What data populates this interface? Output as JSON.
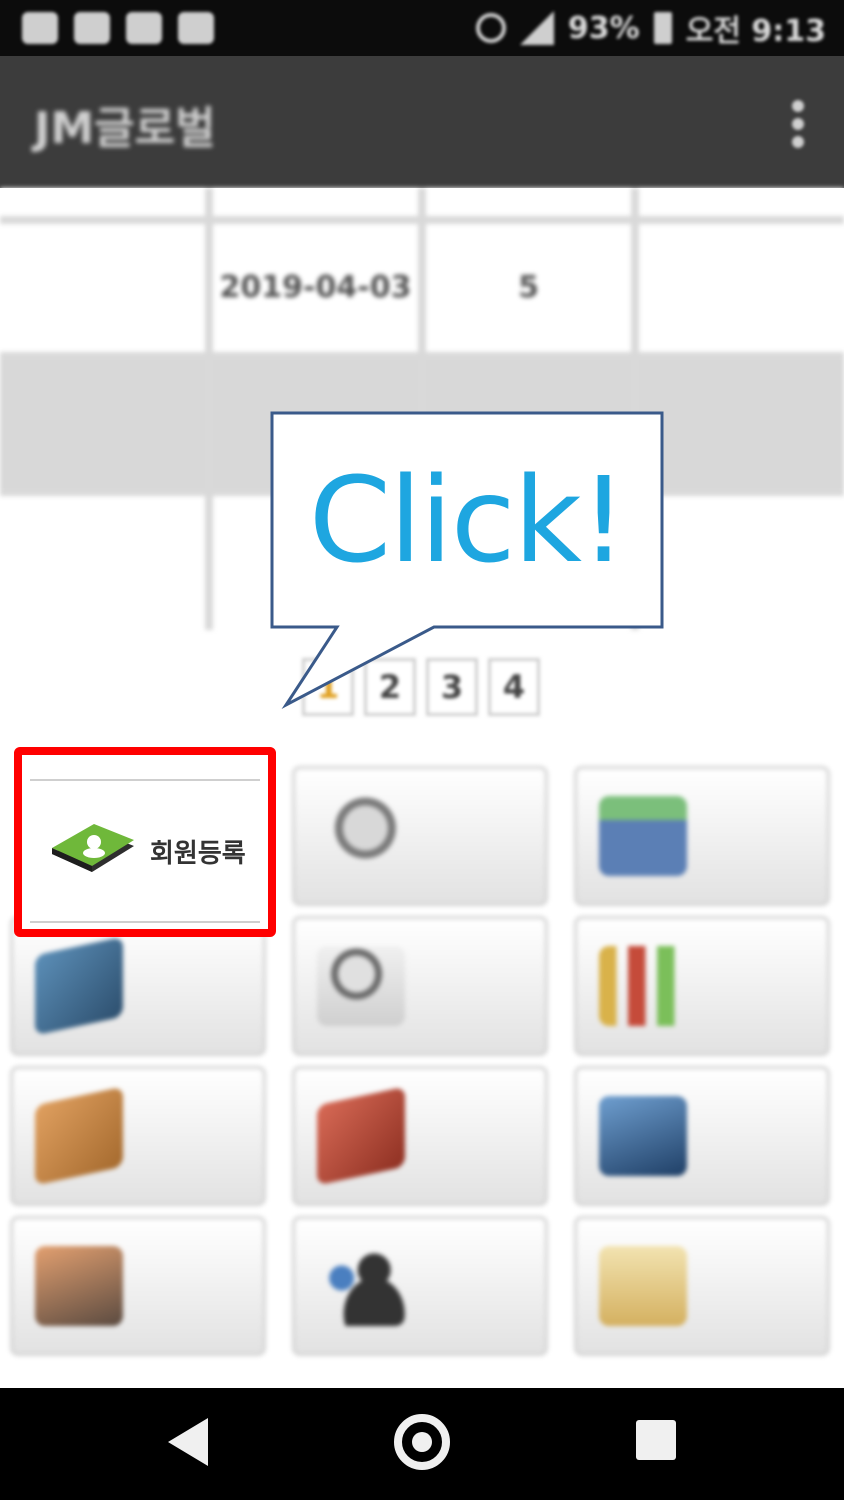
{
  "status_bar": {
    "battery": "93%",
    "time": "오전 9:13",
    "icons": [
      "chat-icon",
      "sim-icon",
      "image-icon",
      "gallery-icon",
      "alarm-icon",
      "signal-icon",
      "battery-icon"
    ]
  },
  "app_bar": {
    "title": "JM글로벌",
    "menu_icon": "overflow-menu-icon"
  },
  "table": {
    "rows": [
      [
        "",
        "2019-04-03",
        "5",
        ""
      ],
      [
        "",
        "",
        "",
        ""
      ],
      [
        "",
        "",
        "",
        ""
      ]
    ]
  },
  "pagination": {
    "pages": [
      "1",
      "2",
      "3",
      "4"
    ],
    "current": "1"
  },
  "callout": {
    "text": "Click!"
  },
  "menu_tiles": [
    {
      "label": "회원등록",
      "icon": "member-register-book-icon",
      "color": "#6fb83a"
    },
    {
      "label": "",
      "icon": "magnifier-icon",
      "color": "#7a7a7a"
    },
    {
      "label": "",
      "icon": "cards-icon",
      "color": "#5b7fb5"
    },
    {
      "label": "",
      "icon": "blue-book-icon",
      "color": "#3a6b92"
    },
    {
      "label": "",
      "icon": "search-document-icon",
      "color": "#8a8a8a"
    },
    {
      "label": "",
      "icon": "bar-chart-icon",
      "color": "#c98a3a"
    },
    {
      "label": "",
      "icon": "orange-book-icon",
      "color": "#c8843e"
    },
    {
      "label": "",
      "icon": "red-book-icon",
      "color": "#b9483a"
    },
    {
      "label": "",
      "icon": "line-chart-blue-icon",
      "color": "#355f90"
    },
    {
      "label": "",
      "icon": "line-chart-orange-icon",
      "color": "#c5764a"
    },
    {
      "label": "",
      "icon": "users-group-icon",
      "color": "#3d5f8f"
    },
    {
      "label": "",
      "icon": "id-card-icon",
      "color": "#c9a64a"
    }
  ],
  "nav_bar": {
    "icons": [
      "back-icon",
      "home-icon",
      "recents-icon"
    ]
  }
}
